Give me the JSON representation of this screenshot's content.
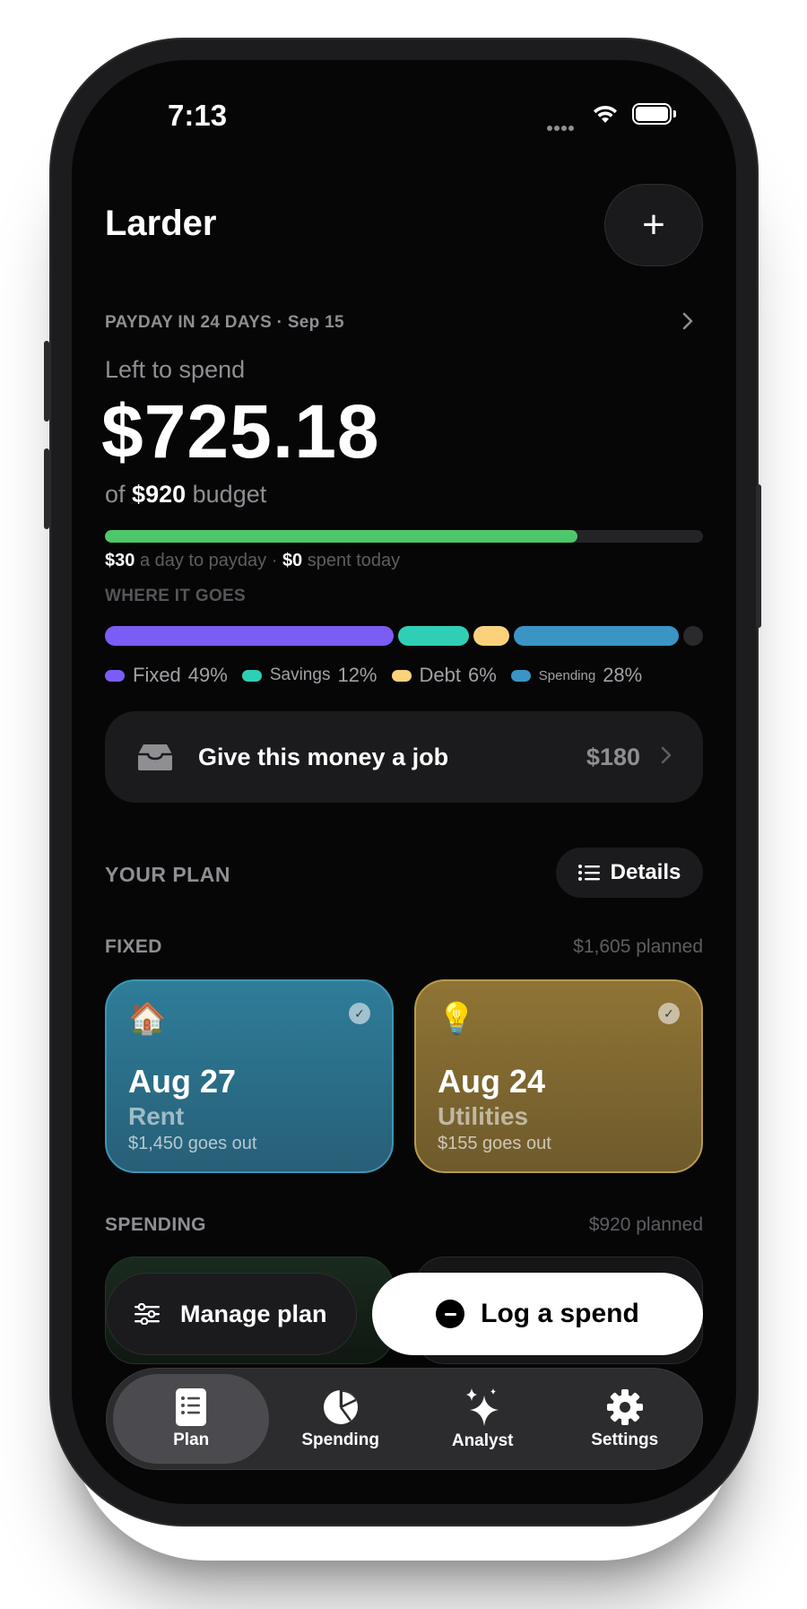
{
  "status": {
    "time": "7:13"
  },
  "header": {
    "title": "Larder",
    "add_label": "+"
  },
  "summary": {
    "payday": "PAYDAY IN 24 DAYS · Sep 15",
    "left_label": "Left to spend",
    "amount": "$725.18",
    "of_prefix": "of",
    "budget": "$920",
    "of_suffix": "budget",
    "progress": 0.79,
    "per_day": "$30",
    "per_day_text": "a day to payday ·",
    "spent_today": "$0",
    "spent_today_text": "spent today"
  },
  "where": {
    "label": "WHERE IT GOES",
    "segments": [
      {
        "name": "Fixed",
        "pct": "49%",
        "value": 49,
        "color": "#7b5cf5",
        "size": "large"
      },
      {
        "name": "Savings",
        "pct": "12%",
        "value": 12,
        "color": "#2fcfb6",
        "size": "small"
      },
      {
        "name": "Debt",
        "pct": "6%",
        "value": 6,
        "color": "#fad27c",
        "size": "large"
      },
      {
        "name": "Spending",
        "pct": "28%",
        "value": 28,
        "color": "#3a94c4",
        "size": "tiny"
      }
    ],
    "remainder_color": "#2a2a2c"
  },
  "job": {
    "label": "Give this money a job",
    "amount": "$180"
  },
  "plan": {
    "label": "YOUR PLAN",
    "details_label": "Details",
    "fixed_label": "FIXED",
    "fixed_planned": "$1,605 planned",
    "bills": [
      {
        "emoji": "🏠",
        "date": "Aug 27",
        "name": "Rent",
        "out": "$1,450 goes out"
      },
      {
        "emoji": "💡",
        "date": "Aug 24",
        "name": "Utilities",
        "out": "$155 goes out"
      }
    ],
    "spending_label": "SPENDING",
    "spending_planned": "$920 planned"
  },
  "actions": {
    "manage_label": "Manage plan",
    "log_label": "Log a spend"
  },
  "tabs": [
    {
      "label": "Plan",
      "icon": "list-doc-icon",
      "active": true
    },
    {
      "label": "Spending",
      "icon": "pie-chart-icon",
      "active": false
    },
    {
      "label": "Analyst",
      "icon": "sparkles-icon",
      "active": false
    },
    {
      "label": "Settings",
      "icon": "gear-icon",
      "active": false
    }
  ]
}
